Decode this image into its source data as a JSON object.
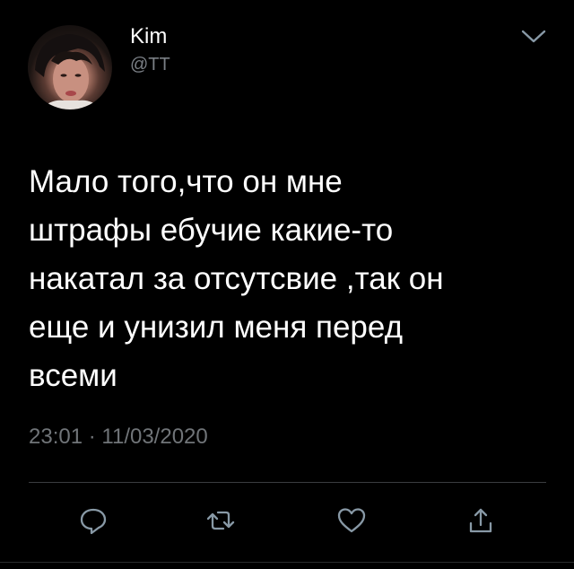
{
  "tweet": {
    "author_name": "Kim",
    "author_handle": "@TT",
    "text": "Мало того,что он мне\nштрафы ебучие какие-то\nнакатал за отсутсвие ,так он\nеще и унизил меня перед\nвсеми",
    "time": "23:01",
    "separator": "·",
    "date": "11/03/2020"
  },
  "icons": {
    "menu": "chevron-down-icon",
    "reply": "reply-icon",
    "retweet": "retweet-icon",
    "like": "heart-icon",
    "share": "share-icon"
  },
  "colors": {
    "background": "#000000",
    "text": "#ffffff",
    "secondary": "#707478",
    "icon": "#8899a6"
  }
}
